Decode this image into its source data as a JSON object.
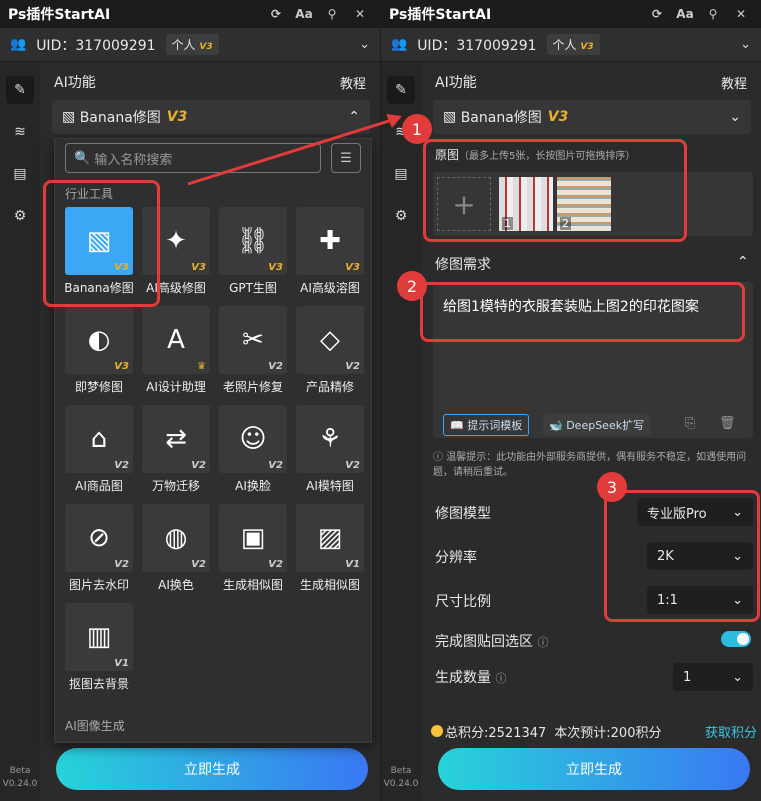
{
  "app_title": "Ps插件StartAI",
  "titlebar_icons": [
    "refresh-icon",
    "font-size-icon",
    "pin-icon",
    "close-icon"
  ],
  "user": {
    "uid": "UID：317009291",
    "plan": "个人",
    "plan_tag": "V3"
  },
  "sidebar": {
    "items": [
      "edit-icon",
      "layers-icon",
      "clipboard-icon",
      "settings-icon"
    ],
    "beta": "Beta",
    "version": "V0.24.0"
  },
  "left": {
    "section_title": "AI功能",
    "tutorial": "教程",
    "selected_tool": "Banana修图",
    "selected_tag": "V3",
    "search_placeholder": "输入名称搜索",
    "category1": "行业工具",
    "category2": "AI图像生成",
    "tools": [
      {
        "label": "Banana修图",
        "tag": "V3"
      },
      {
        "label": "AI高级修图",
        "tag": "V3"
      },
      {
        "label": "GPT生图",
        "tag": "V3"
      },
      {
        "label": "AI高级溶图",
        "tag": "V3"
      },
      {
        "label": "即梦修图",
        "tag": "V3"
      },
      {
        "label": "AI设计助理",
        "tag": "♛"
      },
      {
        "label": "老照片修复",
        "tag": "V2"
      },
      {
        "label": "产品精修",
        "tag": "V2"
      },
      {
        "label": "AI商品图",
        "tag": "V2"
      },
      {
        "label": "万物迁移",
        "tag": "V2"
      },
      {
        "label": "AI换脸",
        "tag": "V2"
      },
      {
        "label": "AI模特图",
        "tag": "V2"
      },
      {
        "label": "图片去水印",
        "tag": "V2"
      },
      {
        "label": "AI换色",
        "tag": "V2"
      },
      {
        "label": "生成相似图",
        "tag": "V2"
      },
      {
        "label": "生成相似图",
        "tag": "V1"
      },
      {
        "label": "抠图去背景",
        "tag": "V1"
      }
    ],
    "generate": "立即生成"
  },
  "right": {
    "section_title": "AI功能",
    "tutorial": "教程",
    "selected_tool": "Banana修图",
    "selected_tag": "V3",
    "orig_label": "原图",
    "orig_hint": "（最多上传5张，长按图片可拖拽排序）",
    "thumb1": "1",
    "thumb2": "2",
    "req_label": "修图需求",
    "req_text": "给图1模特的衣服套装贴上图2的印花图案",
    "chip1": "提示词模板",
    "chip2": "DeepSeek扩写",
    "tip": "温馨提示：此功能由外部服务商提供，偶有服务不稳定，如遇使用问题，请稍后重试。",
    "model_label": "修图模型",
    "model_value": "专业版Pro",
    "res_label": "分辨率",
    "res_value": "2K",
    "ratio_label": "尺寸比例",
    "ratio_value": "1:1",
    "paste_label": "完成图贴回选区",
    "count_label": "生成数量",
    "count_value": "1",
    "points": "总积分:2521347",
    "estimate": "本次预计:200积分",
    "get_points": "获取积分",
    "generate": "立即生成"
  },
  "callouts": [
    "1",
    "2",
    "3"
  ],
  "colors": {
    "accent": "#3aa8f5",
    "red": "#e23b3b",
    "gold": "#e8b02c",
    "gradient_start": "#27d3d9",
    "gradient_end": "#3a78f2"
  }
}
